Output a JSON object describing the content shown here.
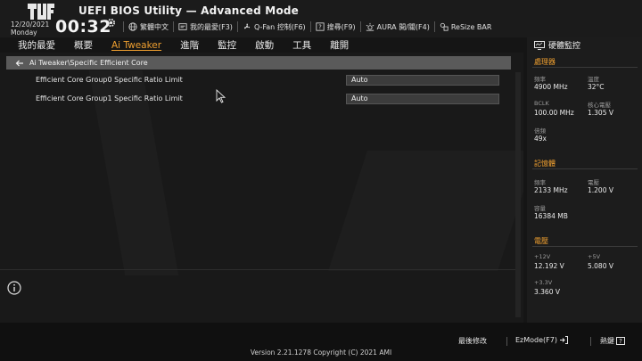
{
  "header": {
    "title": "UEFI BIOS Utility — Advanced Mode",
    "date": "12/20/2021",
    "day": "Monday",
    "time": "00:32",
    "tools": [
      {
        "label": "繁體中文",
        "icon": "globe-icon"
      },
      {
        "label": "我的最愛(F3)",
        "icon": "favorites-icon"
      },
      {
        "label": "Q-Fan 控制(F6)",
        "icon": "fan-icon"
      },
      {
        "label": "搜尋(F9)",
        "icon": "search-help-icon"
      },
      {
        "label": "AURA 開/關(F4)",
        "icon": "aura-icon"
      },
      {
        "label": "ReSize BAR",
        "icon": "resize-bar-icon"
      }
    ]
  },
  "nav": {
    "tabs": [
      "我的最愛",
      "概要",
      "Ai Tweaker",
      "進階",
      "監控",
      "啟動",
      "工具",
      "離開"
    ],
    "active": "Ai Tweaker"
  },
  "main": {
    "breadcrumb": "Ai Tweaker\\Specific Efficient Core",
    "settings": [
      {
        "label": "Efficient Core Group0 Specific Ratio Limit",
        "value": "Auto"
      },
      {
        "label": "Efficient Core Group1 Specific Ratio Limit",
        "value": "Auto"
      }
    ]
  },
  "hw_monitor": {
    "title": "硬體監控",
    "cpu": {
      "section": "處理器",
      "freq_label": "頻率",
      "freq": "4900 MHz",
      "temp_label": "溫度",
      "temp": "32°C",
      "bclk_label": "BCLK",
      "bclk": "100.00 MHz",
      "vcore_label": "核心電壓",
      "vcore": "1.305 V",
      "ratio_label": "倍頻",
      "ratio": "49x"
    },
    "memory": {
      "section": "記憶體",
      "freq_label": "頻率",
      "freq": "2133 MHz",
      "volt_label": "電壓",
      "volt": "1.200 V",
      "cap_label": "容量",
      "cap": "16384 MB"
    },
    "voltage": {
      "section": "電壓",
      "v12_label": "+12V",
      "v12": "12.192 V",
      "v5_label": "+5V",
      "v5": "5.080 V",
      "v33_label": "+3.3V",
      "v33": "3.360 V"
    }
  },
  "footer": {
    "last_modified": "最後修改",
    "ezmode": "EzMode(F7)",
    "hotkeys": "熱鍵",
    "version": "Version 2.21.1278 Copyright (C) 2021 AMI"
  },
  "colors": {
    "accent": "#f0a030",
    "background": "#151515",
    "panel": "#1c1c1c",
    "breadcrumb_bg": "#5a5a5a"
  }
}
